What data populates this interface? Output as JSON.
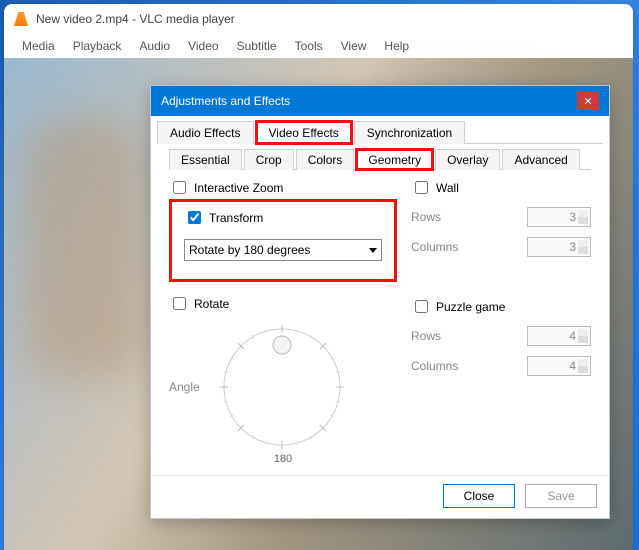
{
  "app": {
    "title": "New video 2.mp4 - VLC media player"
  },
  "menu": {
    "items": [
      "Media",
      "Playback",
      "Audio",
      "Video",
      "Subtitle",
      "Tools",
      "View",
      "Help"
    ]
  },
  "dialog": {
    "title": "Adjustments and Effects",
    "tabs": {
      "audio": "Audio Effects",
      "video": "Video Effects",
      "sync": "Synchronization"
    },
    "subtabs": {
      "essential": "Essential",
      "crop": "Crop",
      "colors": "Colors",
      "geometry": "Geometry",
      "overlay": "Overlay",
      "advanced": "Advanced"
    },
    "interactive_zoom": "Interactive Zoom",
    "transform": {
      "label": "Transform",
      "checked": true,
      "option": "Rotate by 180 degrees"
    },
    "rotate": {
      "label": "Rotate",
      "angle_label": "Angle",
      "bottom_label": "180"
    },
    "wall": {
      "label": "Wall",
      "rows_label": "Rows",
      "rows_value": "3",
      "cols_label": "Columns",
      "cols_value": "3"
    },
    "puzzle": {
      "label": "Puzzle game",
      "rows_label": "Rows",
      "rows_value": "4",
      "cols_label": "Columns",
      "cols_value": "4"
    },
    "buttons": {
      "close": "Close",
      "save": "Save"
    }
  }
}
